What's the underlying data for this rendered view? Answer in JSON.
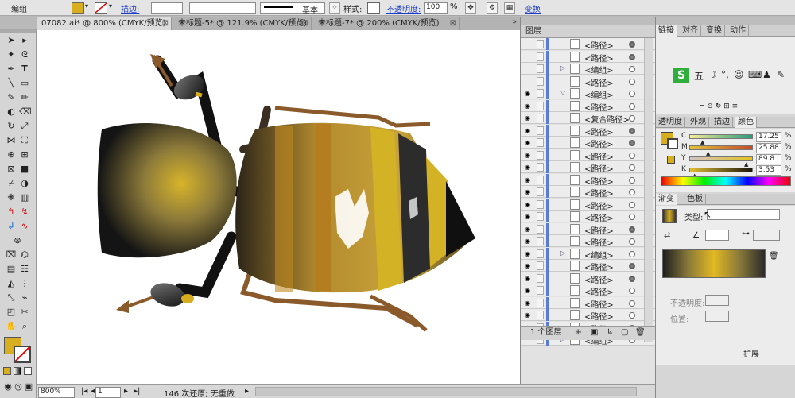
{
  "control_bar": {
    "selection_type": "编组",
    "stroke_link": "描边:",
    "stroke_style": "基本",
    "style_label": "样式:",
    "opacity_link": "不透明度:",
    "opacity_value": "100",
    "opacity_unit": "%",
    "transform_link": "变换",
    "fill_color": "#d7ae1f"
  },
  "doc_tabs": [
    {
      "label": "07082.ai* @ 800% (CMYK/预览)",
      "close": "⊠"
    },
    {
      "label": "未标题-5* @ 121.9% (CMYK/预览)",
      "close": "⊠"
    },
    {
      "label": "未标题-7* @ 200% (CMYK/预览)",
      "close": "⊠"
    }
  ],
  "status": {
    "zoom": "800%",
    "artboard": "1",
    "history": "146 次还原; 无重做"
  },
  "layers": {
    "title": "图层",
    "footer": "1 个图层",
    "rows": [
      {
        "name": "<路径>",
        "eye": "",
        "arrow": "",
        "filled": true
      },
      {
        "name": "<路径>",
        "eye": "",
        "arrow": "",
        "filled": true
      },
      {
        "name": "<编组>",
        "eye": "",
        "arrow": "▷",
        "filled": false
      },
      {
        "name": "<路径>",
        "eye": "",
        "arrow": "",
        "filled": false
      },
      {
        "name": "<编组>",
        "eye": "◉",
        "arrow": "▽",
        "filled": false
      },
      {
        "name": "<路径>",
        "eye": "◉",
        "arrow": "",
        "filled": false
      },
      {
        "name": "<复合路径>",
        "eye": "◉",
        "arrow": "",
        "filled": false
      },
      {
        "name": "<路径>",
        "eye": "◉",
        "arrow": "",
        "filled": true
      },
      {
        "name": "<路径>",
        "eye": "◉",
        "arrow": "",
        "filled": true
      },
      {
        "name": "<路径>",
        "eye": "◉",
        "arrow": "",
        "filled": false
      },
      {
        "name": "<路径>",
        "eye": "◉",
        "arrow": "",
        "filled": false
      },
      {
        "name": "<路径>",
        "eye": "◉",
        "arrow": "",
        "filled": false
      },
      {
        "name": "<路径>",
        "eye": "◉",
        "arrow": "",
        "filled": false
      },
      {
        "name": "<路径>",
        "eye": "◉",
        "arrow": "",
        "filled": false
      },
      {
        "name": "<路径>",
        "eye": "◉",
        "arrow": "",
        "filled": false
      },
      {
        "name": "<路径>",
        "eye": "◉",
        "arrow": "",
        "filled": true
      },
      {
        "name": "<路径>",
        "eye": "◉",
        "arrow": "",
        "filled": false
      },
      {
        "name": "<编组>",
        "eye": "◉",
        "arrow": "▷",
        "filled": false
      },
      {
        "name": "<路径>",
        "eye": "◉",
        "arrow": "",
        "filled": true
      },
      {
        "name": "<路径>",
        "eye": "◉",
        "arrow": "",
        "filled": true
      },
      {
        "name": "<路径>",
        "eye": "◉",
        "arrow": "",
        "filled": false
      },
      {
        "name": "<路径>",
        "eye": "◉",
        "arrow": "",
        "filled": false
      },
      {
        "name": "<路径>",
        "eye": "◉",
        "arrow": "",
        "filled": false
      },
      {
        "name": "<路径>",
        "eye": "◉",
        "arrow": "",
        "filled": false
      },
      {
        "name": "<编组>",
        "eye": "",
        "arrow": "▷",
        "filled": false
      }
    ]
  },
  "panels": {
    "top_tabs": [
      "链接",
      "对齐",
      "变换",
      "动作"
    ],
    "ime_text": "五",
    "color_tabs": [
      "透明度",
      "外观",
      "描边",
      "颜色"
    ],
    "cmyk": [
      {
        "ch": "C",
        "value": "17.25",
        "level": 0.17
      },
      {
        "ch": "M",
        "value": "25.88",
        "level": 0.26
      },
      {
        "ch": "Y",
        "value": "89.8",
        "level": 0.9
      },
      {
        "ch": "K",
        "value": "3.53",
        "level": 0.04
      }
    ],
    "grad_tabs": [
      "渐变",
      "色板"
    ],
    "grad_type_label": "类型:",
    "opacity_label": "不透明度:",
    "location_label": "位置:",
    "bottom_label": "扩展"
  }
}
